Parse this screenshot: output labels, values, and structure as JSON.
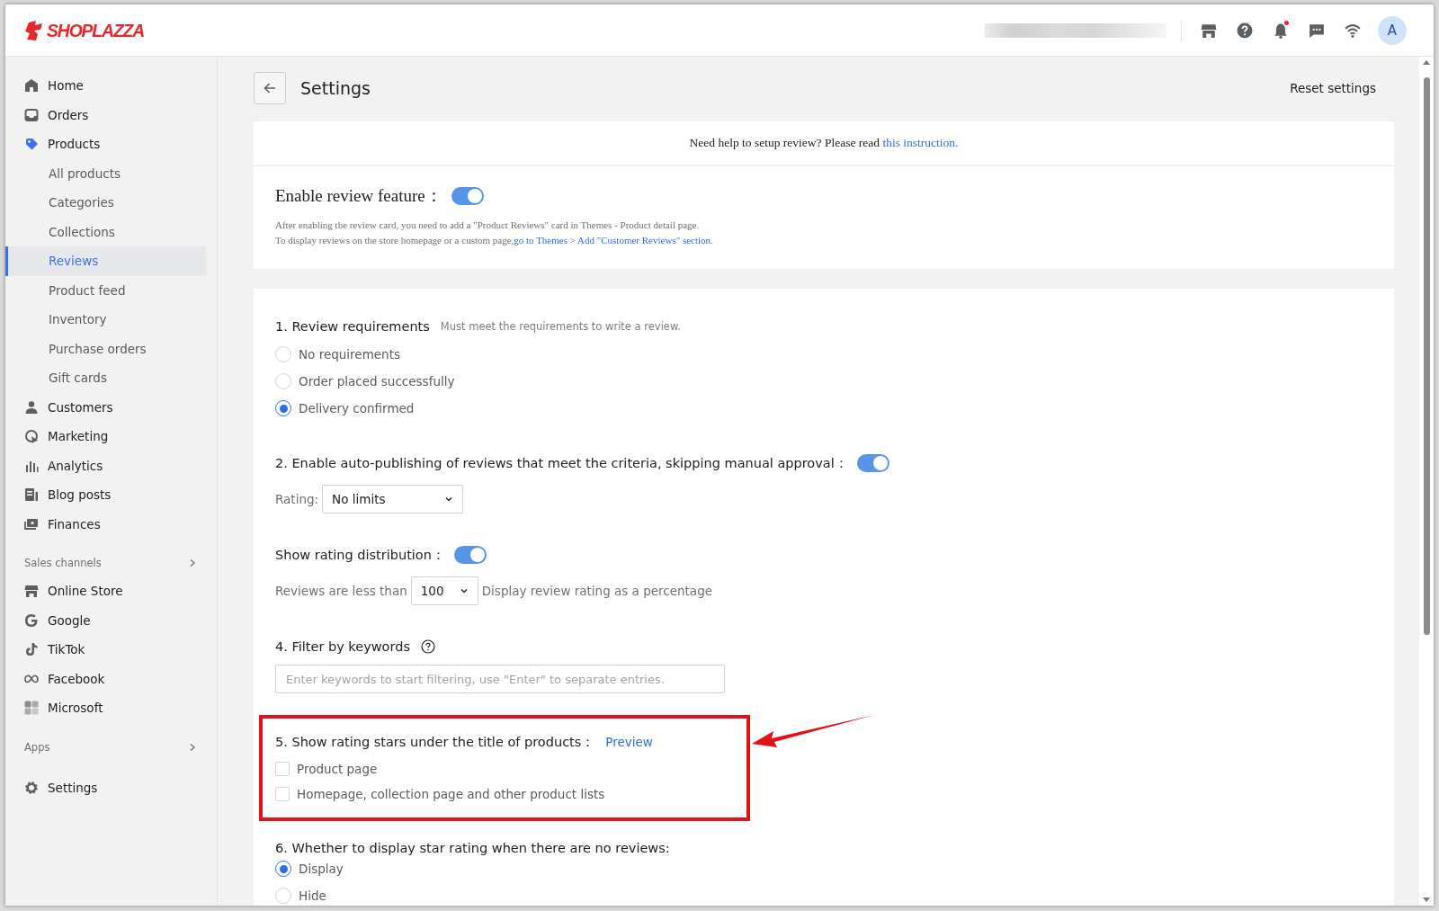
{
  "header": {
    "logo": "SHOPLAZZA",
    "avatar": "A",
    "notification_dot": true
  },
  "sidebar": {
    "nav": [
      {
        "label": "Home",
        "selected": false
      },
      {
        "label": "Orders",
        "selected": false
      },
      {
        "label": "Products",
        "selected": false,
        "children": [
          {
            "label": "All products",
            "selected": false
          },
          {
            "label": "Categories",
            "selected": false
          },
          {
            "label": "Collections",
            "selected": false
          },
          {
            "label": "Reviews",
            "selected": true
          },
          {
            "label": "Product feed",
            "selected": false
          },
          {
            "label": "Inventory",
            "selected": false
          },
          {
            "label": "Purchase orders",
            "selected": false
          },
          {
            "label": "Gift cards",
            "selected": false
          }
        ]
      },
      {
        "label": "Customers",
        "selected": false
      },
      {
        "label": "Marketing",
        "selected": false
      },
      {
        "label": "Analytics",
        "selected": false
      },
      {
        "label": "Blog posts",
        "selected": false
      },
      {
        "label": "Finances",
        "selected": false
      }
    ],
    "sales_channels": {
      "title": "Sales channels",
      "items": [
        {
          "label": "Online Store",
          "selected": false
        },
        {
          "label": "Google",
          "selected": false
        },
        {
          "label": "TikTok",
          "selected": false
        },
        {
          "label": "Facebook",
          "selected": false
        },
        {
          "label": "Microsoft",
          "selected": false
        }
      ]
    },
    "apps": {
      "title": "Apps"
    },
    "footer": {
      "label": "Settings",
      "selected": false
    }
  },
  "page": {
    "title": "Settings",
    "reset_button": "Reset settings"
  },
  "help": {
    "text": "Need help to setup review? Please read ",
    "link": "this instruction."
  },
  "enable": {
    "label": "Enable review feature：",
    "on": true,
    "note_1": "After enabling the review card, you need to add a \"Product Reviews\" card in Themes - Product detail page.",
    "note_2": "To display reviews on the store homepage or a custom page,",
    "note_2_link": "go to Themes > Add \"Customer Reviews\" section."
  },
  "requirements": {
    "title": "1. Review requirements",
    "hint": "Must meet the requirements to write a review.",
    "options": [
      {
        "label": "No requirements",
        "selected": false
      },
      {
        "label": "Order placed successfully",
        "selected": false
      },
      {
        "label": "Delivery confirmed",
        "selected": true
      }
    ]
  },
  "auto_publish": {
    "label": "2. Enable auto-publishing of reviews that meet the criteria, skipping manual approval：",
    "on": true,
    "rating_label": "Rating:",
    "rating_value": "No limits"
  },
  "distribution": {
    "label": "Show rating distribution：",
    "on": true,
    "prefix": "Reviews are less than",
    "value": "100",
    "suffix": "Display review rating as a percentage"
  },
  "keywords": {
    "title": "4. Filter by keywords",
    "placeholder": "Enter keywords to start filtering, use \"Enter\" to separate entries."
  },
  "stars": {
    "title": "5. Show rating stars under the title of products：",
    "link": "Preview",
    "options": [
      {
        "label": "Product page",
        "checked": false
      },
      {
        "label": "Homepage, collection page and other product lists",
        "checked": false
      }
    ]
  },
  "no_reviews": {
    "title": "6. Whether to display star rating when there are no reviews:",
    "options": [
      {
        "label": "Display",
        "selected": true
      },
      {
        "label": "Hide",
        "selected": false
      }
    ]
  }
}
